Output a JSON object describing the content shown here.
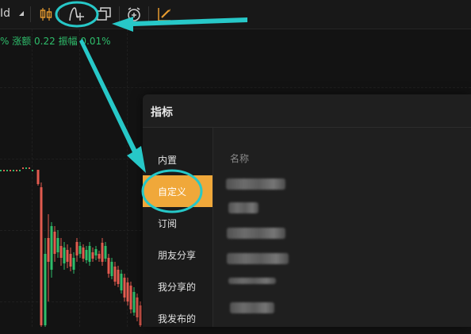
{
  "toolbar": {
    "timeframe_label": "Id",
    "icons": [
      "dropdown-caret",
      "candlestick-icon",
      "indicator-icon",
      "layout-windows-icon",
      "alarm-clock-icon",
      "drawing-pen-icon"
    ]
  },
  "info_line": {
    "text": "% 涨额 0.22 振幅 0.01%"
  },
  "panel": {
    "title": "指标",
    "column_header": "名称",
    "menu": [
      {
        "label": "内置",
        "active": false
      },
      {
        "label": "自定义",
        "active": true
      },
      {
        "label": "订阅",
        "active": false
      },
      {
        "label": "朋友分享",
        "active": false
      },
      {
        "label": "我分享的",
        "active": false
      },
      {
        "label": "我发布的",
        "active": false
      }
    ],
    "blurred_names": 6
  },
  "colors": {
    "background": "#131313",
    "panel": "#1f1f1f",
    "active_item": "#f0a83a",
    "up": "#2ebd6b",
    "down": "#e25b4f",
    "annotation": "#27c8c8"
  }
}
